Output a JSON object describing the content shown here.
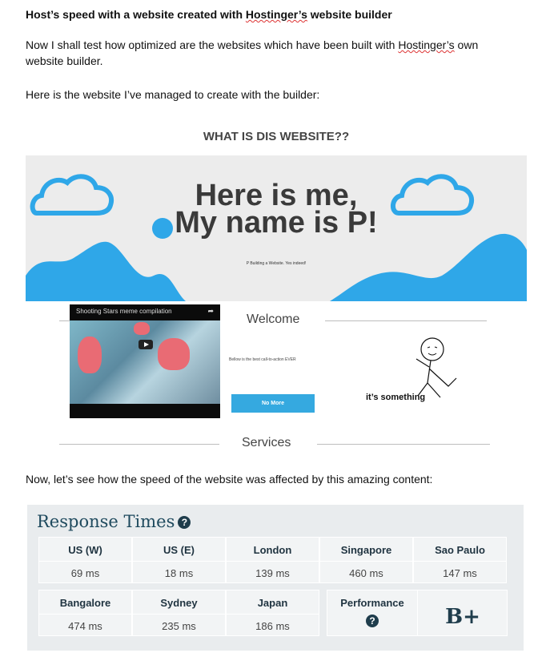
{
  "article": {
    "heading_prefix": "Host’s speed with a website created with ",
    "heading_brand": "Hostinger’s",
    "heading_suffix": " website builder",
    "para1_prefix": "Now I shall test how optimized are the websites which have been built with ",
    "para1_brand": "Hostinger’s",
    "para1_suffix": " own website builder.",
    "para2": "Here is the website I’ve managed to create with the builder:",
    "para3": "Now, let’s see how the speed of the website was affected by this amazing content:"
  },
  "site_shot": {
    "title": "WHAT IS DIS WEBSITE??",
    "hero_line1": "Here is me,",
    "hero_line2": "My name is P!",
    "hero_sub": "P Building a Website. Yes indeed!",
    "video_title": "Shooting Stars meme compilation",
    "welcome": "Welcome",
    "cta_text": "Bellow is the best call-to-action EVER",
    "cta_button": "No More",
    "meme_caption": "it’s something",
    "services": "Services",
    "colors": {
      "accent": "#2fa7e8",
      "hero_bg": "#ececec"
    }
  },
  "response_times": {
    "title": "Response Times",
    "help_icon": "question-circle-icon",
    "row1": [
      {
        "location": "US (W)",
        "time": "69 ms"
      },
      {
        "location": "US (E)",
        "time": "18 ms"
      },
      {
        "location": "London",
        "time": "139 ms"
      },
      {
        "location": "Singapore",
        "time": "460 ms"
      },
      {
        "location": "Sao Paulo",
        "time": "147 ms"
      }
    ],
    "row2": [
      {
        "location": "Bangalore",
        "time": "474 ms"
      },
      {
        "location": "Sydney",
        "time": "235 ms"
      },
      {
        "location": "Japan",
        "time": "186 ms"
      }
    ],
    "performance_label": "Performance",
    "performance_grade": "B+"
  }
}
